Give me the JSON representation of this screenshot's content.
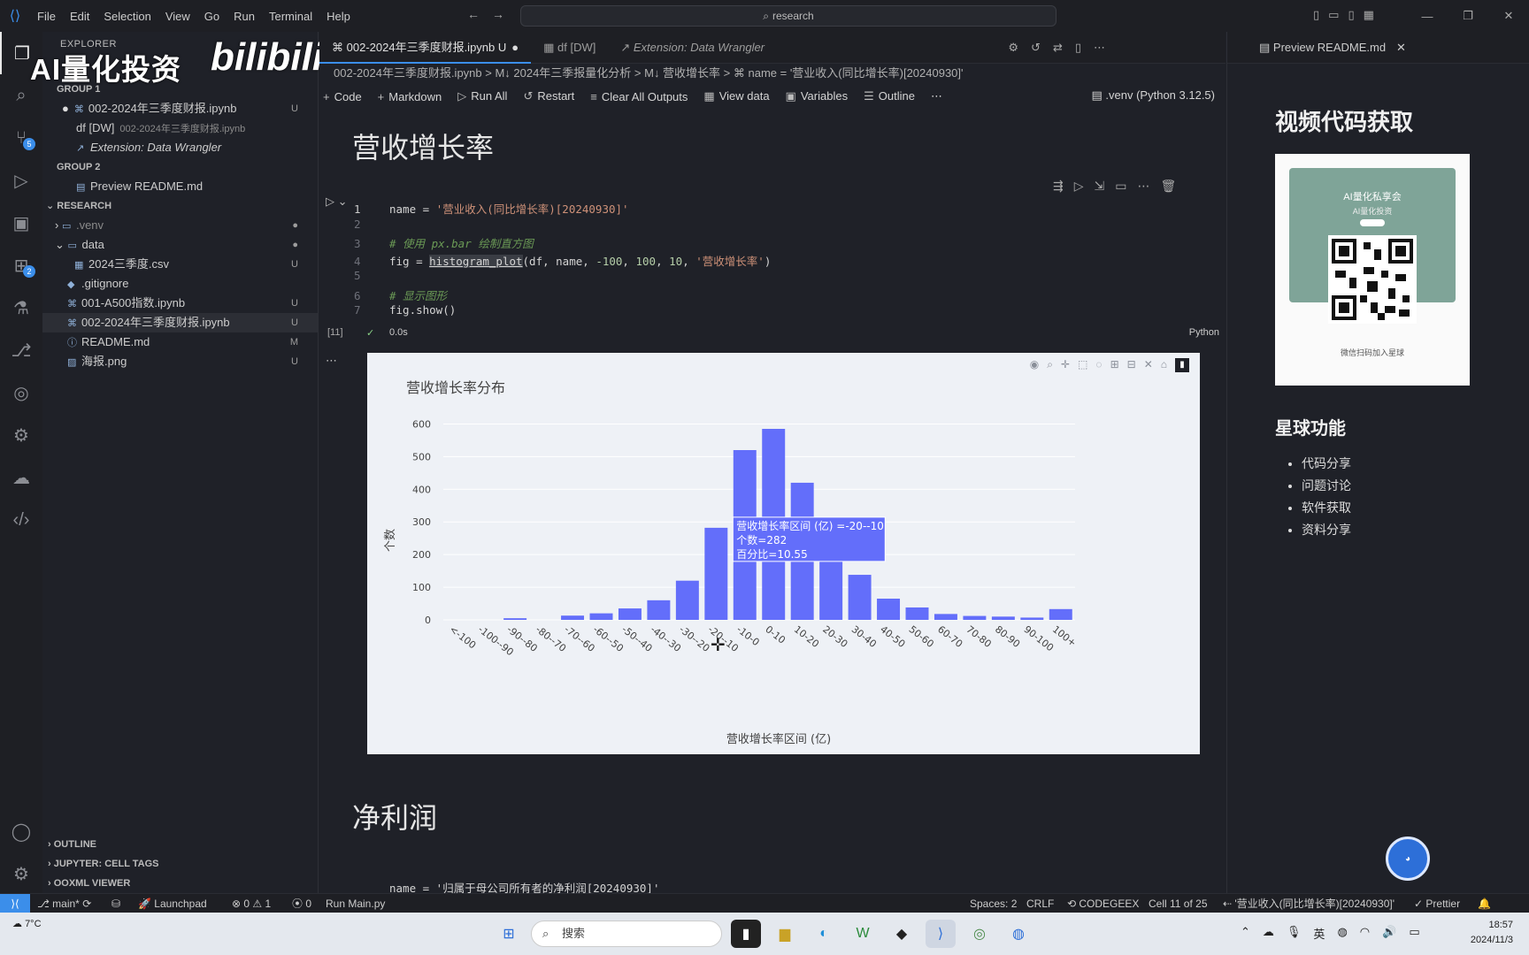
{
  "titlebar": {
    "menu": [
      "File",
      "Edit",
      "Selection",
      "View",
      "Go",
      "Run",
      "Terminal",
      "Help"
    ],
    "search": "research"
  },
  "watermark": {
    "text": "AI量化投资",
    "site": "bilibili"
  },
  "activity_badges": {
    "scm": "5",
    "extensions": "2"
  },
  "explorer": {
    "header": "EXPLORER",
    "group1": "GROUP 1",
    "group1_items": [
      {
        "name": "002-2024年三季度财报.ipynb",
        "status": "U"
      },
      {
        "name": "df [DW]",
        "sub": "002-2024年三季度财报.ipynb"
      },
      {
        "name": "Extension: Data Wrangler"
      }
    ],
    "group2": "GROUP 2",
    "group2_items": [
      {
        "name": "Preview README.md"
      }
    ],
    "root": "RESEARCH",
    "files": [
      {
        "name": ".venv",
        "status": ""
      },
      {
        "name": "data",
        "status": ""
      },
      {
        "name": "2024三季度.csv",
        "status": "U"
      },
      {
        "name": ".gitignore",
        "status": ""
      },
      {
        "name": "001-A500指数.ipynb",
        "status": "U"
      },
      {
        "name": "002-2024年三季度财报.ipynb",
        "status": "U"
      },
      {
        "name": "README.md",
        "status": "M"
      },
      {
        "name": "海报.png",
        "status": "U"
      }
    ],
    "bottom_sections": [
      "OUTLINE",
      "JUPYTER: CELL TAGS",
      "OOXML VIEWER"
    ]
  },
  "tabs": [
    {
      "label": "002-2024年三季度财报.ipynb U"
    },
    {
      "label": "df [DW]"
    },
    {
      "label": "Extension: Data Wrangler"
    }
  ],
  "breadcrumb": "002-2024年三季度财报.ipynb > M↓ 2024年三季报量化分析 > M↓ 营收增长率 > ⌘ name = '营业收入(同比增长率)[20240930]'",
  "toolbar": {
    "items": [
      "Code",
      "Markdown",
      "Run All",
      "Restart",
      "Clear All Outputs",
      "View data",
      "Variables",
      "Outline"
    ],
    "kernel": ".venv (Python 3.12.5)"
  },
  "notebook": {
    "heading1": "营收增长率",
    "heading2": "净利润",
    "code_line1_num": "1",
    "next_cell_code": "name = '归属于母公司所有者的净利润[20240930]'",
    "exec_count": "[11]",
    "exec_time": "0.0s",
    "language": "Python"
  },
  "chart_data": {
    "type": "bar",
    "title": "营收增长率分布",
    "xlabel": "营收增长率区间 (亿)",
    "ylabel": "个数",
    "ylim": [
      0,
      650
    ],
    "yticks": [
      0,
      100,
      200,
      300,
      400,
      500,
      600
    ],
    "categories": [
      "<-100",
      "-100--90",
      "-90--80",
      "-80--70",
      "-70--60",
      "-60--50",
      "-50--40",
      "-40--30",
      "-30--20",
      "-20--10",
      "-10-0",
      "0-10",
      "10-20",
      "20-30",
      "30-40",
      "40-50",
      "50-60",
      "60-70",
      "70-80",
      "80-90",
      "90-100",
      "100+"
    ],
    "values": [
      0,
      0,
      5,
      0,
      13,
      20,
      35,
      60,
      120,
      282,
      520,
      585,
      420,
      260,
      138,
      65,
      38,
      18,
      12,
      10,
      7,
      33
    ],
    "bar_color": "#636efa",
    "background": "#eef1f6",
    "tooltip": {
      "line1": "营收增长率区间 (亿) =-20--10",
      "line2": "个数=282",
      "line3": "百分比=10.55"
    }
  },
  "right_panel": {
    "tab": "Preview README.md",
    "h2": "视频代码获取",
    "qr_title": "AI量化私享会",
    "qr_sub": "AI量化投资",
    "qr_caption": "微信扫码加入星球",
    "h3": "星球功能",
    "features": [
      "代码分享",
      "问题讨论",
      "软件获取",
      "资料分享"
    ]
  },
  "statusbar": {
    "branch": "main*",
    "launchpad": "Launchpad",
    "problems": "⊗ 0 ⚠ 1",
    "ports": "0",
    "run": "Run Main.py",
    "spaces": "Spaces: 2",
    "eol": "CRLF",
    "codegeex": "CODEGEEX",
    "cell": "Cell 11 of 25",
    "cellname": "'营业收入(同比增长率)[20240930]'",
    "prettier": "Prettier"
  },
  "taskbar": {
    "temp": "7°C",
    "search": "搜索",
    "ime": "英",
    "time": "18:57",
    "date": "2024/11/3"
  }
}
